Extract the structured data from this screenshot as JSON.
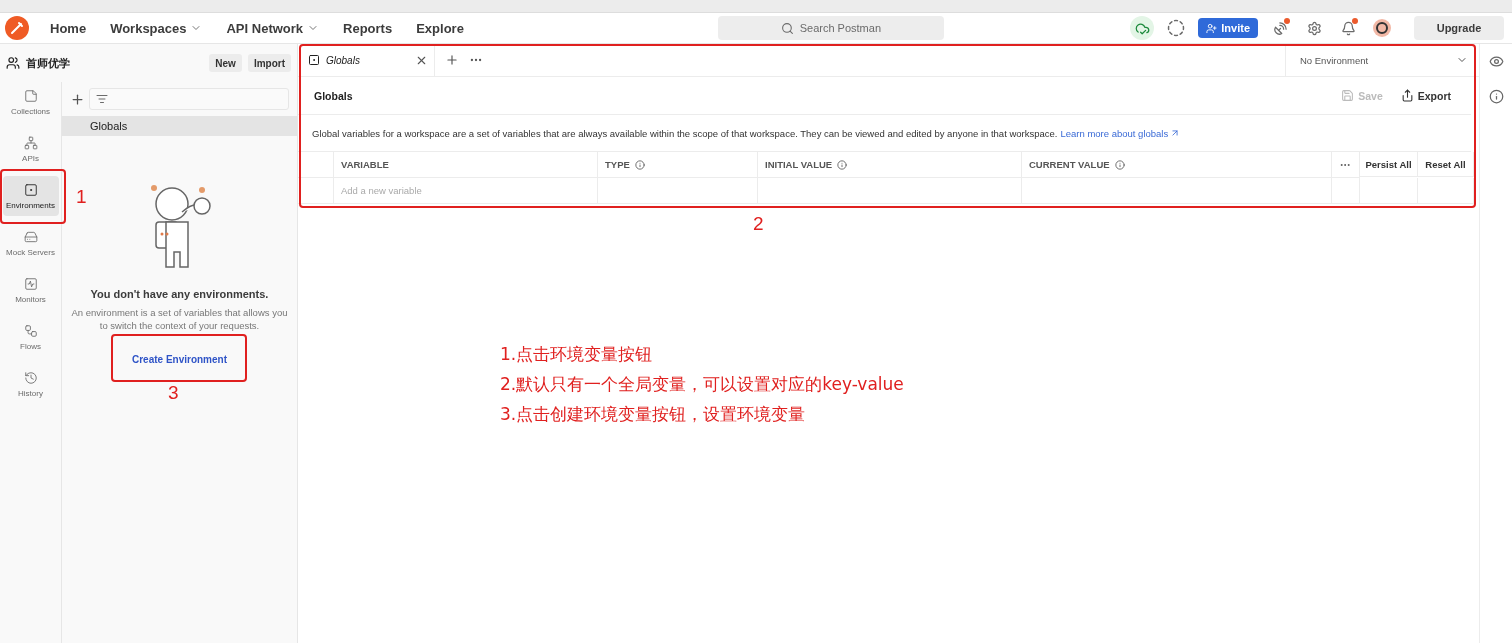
{
  "header": {
    "nav": [
      {
        "label": "Home",
        "dropdown": false
      },
      {
        "label": "Workspaces",
        "dropdown": true
      },
      {
        "label": "API Network",
        "dropdown": true
      },
      {
        "label": "Reports",
        "dropdown": false
      },
      {
        "label": "Explore",
        "dropdown": false
      }
    ],
    "search": {
      "placeholder": "Search Postman"
    },
    "icons": [
      {
        "kind": "cloud",
        "badge": false
      },
      {
        "kind": "agent",
        "badge": false
      }
    ],
    "invite": "Invite",
    "tools": [
      {
        "kind": "satellite",
        "badge": true
      },
      {
        "kind": "settings",
        "badge": false
      },
      {
        "kind": "bell",
        "badge": true
      },
      {
        "kind": "avatar",
        "badge": false
      }
    ],
    "upgrade": "Upgrade"
  },
  "workspace": {
    "name": "首师优学",
    "buttons": [
      "New",
      "Import"
    ]
  },
  "rail": [
    {
      "label": "Collections",
      "kind": "collections",
      "selected": false
    },
    {
      "label": "APIs",
      "kind": "apis",
      "selected": false
    },
    {
      "label": "Environments",
      "kind": "environments",
      "selected": true
    },
    {
      "label": "Mock Servers",
      "kind": "mocks",
      "selected": false
    },
    {
      "label": "Monitors",
      "kind": "monitors",
      "selected": false
    },
    {
      "label": "Flows",
      "kind": "flows",
      "selected": false
    },
    {
      "label": "History",
      "kind": "history",
      "selected": false
    }
  ],
  "sidebar": {
    "items": [
      {
        "label": "Globals",
        "selected": true
      }
    ],
    "empty": {
      "title": "You don't have any environments.",
      "text": "An environment is a set of variables that allows you to switch the context of your requests.",
      "action": "Create Environment"
    }
  },
  "tabs": [
    {
      "label": "Globals",
      "selected": true
    }
  ],
  "environment": "No Environment",
  "globals": {
    "title": "Globals",
    "actions": [
      {
        "label": "Save",
        "kind": "save",
        "disabled": true
      },
      {
        "label": "Export",
        "kind": "export",
        "disabled": false
      }
    ],
    "description": "Global variables for a workspace are a set of variables that are always available within the scope of that workspace. They can be viewed and edited by anyone in that workspace.",
    "link": "Learn more about globals",
    "columns": [
      {
        "label": "VARIABLE",
        "info": false
      },
      {
        "label": "TYPE",
        "info": true
      },
      {
        "label": "INITIAL VALUE",
        "info": true
      },
      {
        "label": "CURRENT VALUE",
        "info": true
      }
    ],
    "bulk": [
      "Persist All",
      "Reset All"
    ],
    "placeholder": "Add a new variable"
  },
  "annotations": {
    "numbers": [
      "1",
      "2",
      "3"
    ],
    "notes": [
      "1.点击环境变量按钮",
      "2.默认只有一个全局变量，可以设置对应的key-value",
      "3.点击创建环境变量按钮，设置环境变量"
    ]
  }
}
